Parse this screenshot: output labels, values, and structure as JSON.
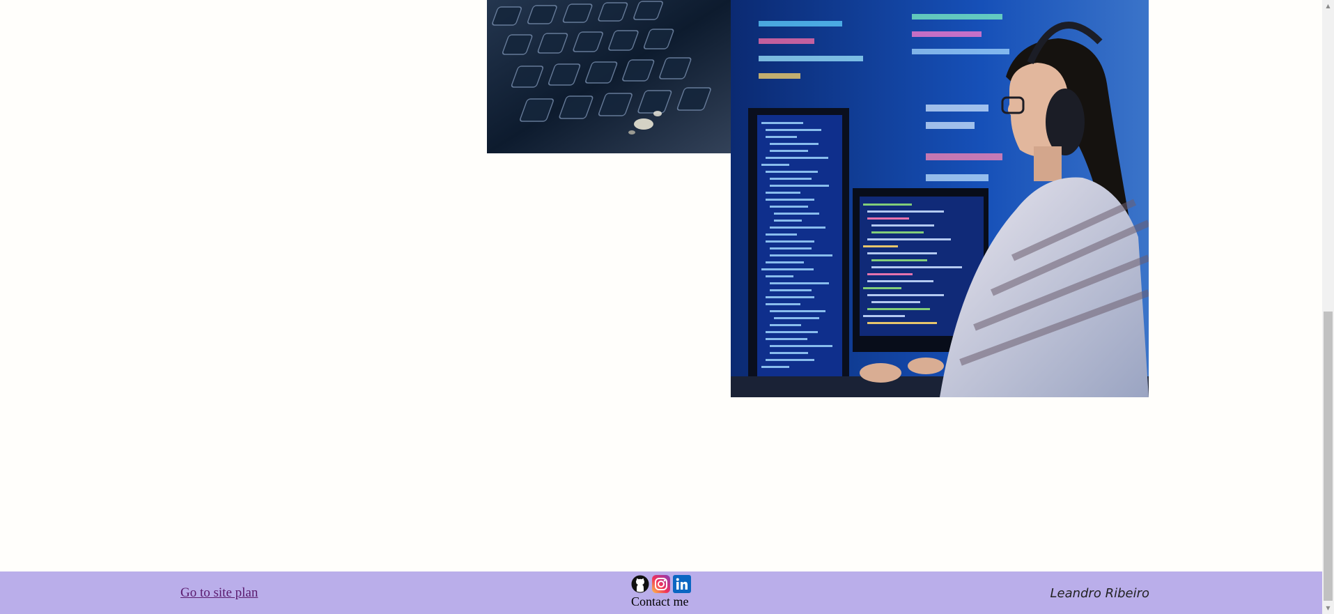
{
  "images": {
    "keyboard_photo": "keyboard close-up photo",
    "developer_photo": "developer wearing headphones coding at monitors photo"
  },
  "footer": {
    "site_plan_link": "Go to site plan",
    "contact_label": "Contact me",
    "author": "Leandro Ribeiro",
    "social_icons": [
      "github-icon",
      "instagram-icon",
      "linkedin-icon"
    ],
    "background_color": "#baaeea",
    "link_color": "#5a1a6e"
  },
  "colors": {
    "page_background": "#fffefb"
  }
}
